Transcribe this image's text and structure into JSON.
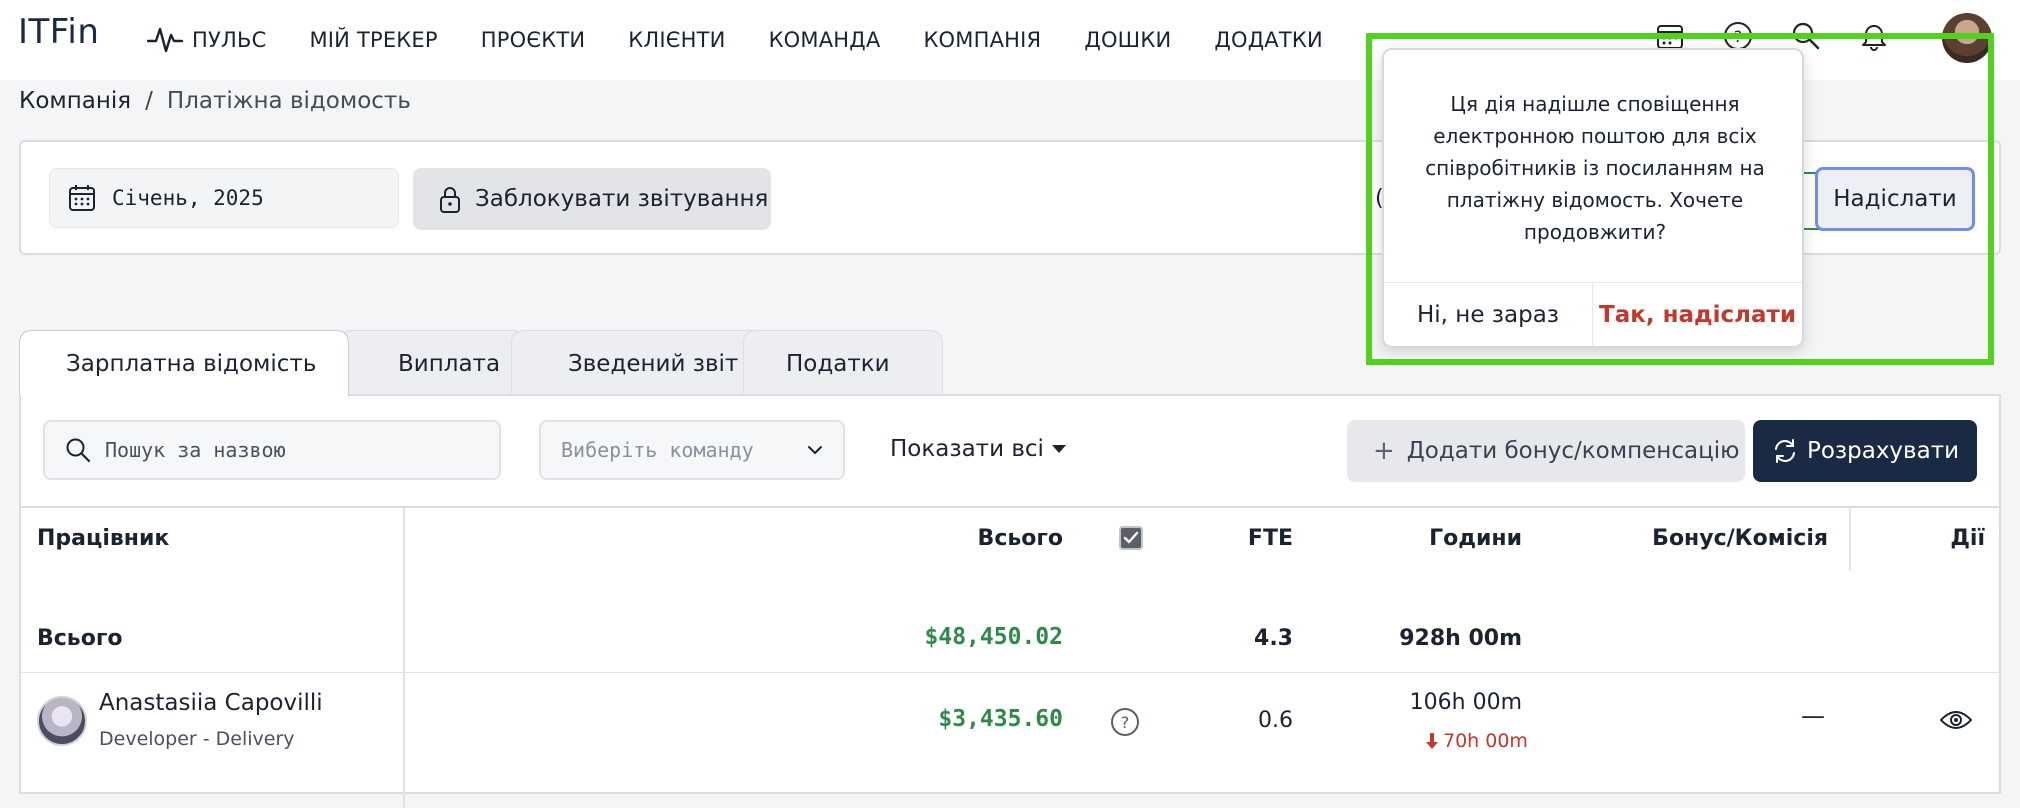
{
  "app": {
    "logo": "ITFin"
  },
  "nav": {
    "items": [
      {
        "label": "ПУЛЬС"
      },
      {
        "label": "МІЙ ТРЕКЕР"
      },
      {
        "label": "ПРОЄКТИ"
      },
      {
        "label": "КЛІЄНТИ"
      },
      {
        "label": "КОМАНДА"
      },
      {
        "label": "КОМПАНІЯ"
      },
      {
        "label": "ДОШКИ"
      },
      {
        "label": "ДОДАТКИ"
      }
    ],
    "icons": [
      "calendar-icon",
      "help-icon",
      "search-icon",
      "bell-icon"
    ]
  },
  "breadcrumb": {
    "root": "Компанія",
    "separator": "/",
    "current": "Платіжна відомость"
  },
  "filters": {
    "month": "Січень, 2025",
    "lock_label": "Заблокувати звітування",
    "send_label": "Надіслати",
    "partial_label": "("
  },
  "popover": {
    "message": "Ця дія надішле сповіщення електронною поштою для всіх співробітників із посиланням на платіжну відомость. Хочете продовжити?",
    "cancel_label": "Ні, не зараз",
    "confirm_label": "Так, надіслати"
  },
  "tabs": [
    {
      "label": "Зарплатна відомість",
      "active": true
    },
    {
      "label": "Виплата",
      "active": false
    },
    {
      "label": "Зведений звіт",
      "active": false
    },
    {
      "label": "Податки",
      "active": false
    }
  ],
  "toolbar": {
    "search_placeholder": "Пошук за назвою",
    "team_placeholder": "Виберіть команду",
    "show_all_label": "Показати всі",
    "add_bonus_label": "Додати бонус/компенсацію",
    "calculate_label": "Розрахувати"
  },
  "table": {
    "columns": {
      "employee": "Працівник",
      "total": "Всього",
      "fte": "FTE",
      "hours": "Години",
      "bonus": "Бонус/Комісія",
      "actions": "Дії"
    },
    "totals": {
      "label": "Всього",
      "amount": "$48,450.02",
      "fte": "4.3",
      "hours": "928h 00m"
    },
    "rows": [
      {
        "name": "Anastasiia Capovilli",
        "role": "Developer - Delivery",
        "amount": "$3,435.60",
        "fte": "0.6",
        "hours": "106h 00m",
        "hours_diff": "70h 00m",
        "bonus": "—"
      }
    ]
  },
  "colors": {
    "accent_green": "#52d21d",
    "money_green": "#2f8a4a",
    "danger_red": "#c0392b",
    "navy": "#1b2a44"
  }
}
